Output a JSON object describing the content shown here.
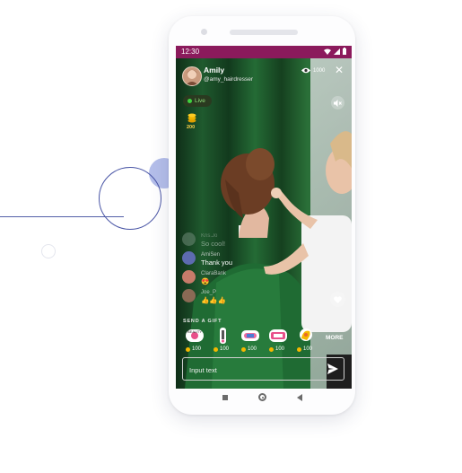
{
  "status_bar": {
    "time": "12:30"
  },
  "stream": {
    "host_name": "Amily",
    "host_handle": "@amy_hairdresser",
    "viewer_count": "1000",
    "live_label": "Live",
    "coin_balance": "200"
  },
  "comments": [
    {
      "user": "Kris.Jo",
      "message": "So cool!",
      "avatar_color": "#6f8a78"
    },
    {
      "user": "AmiSen",
      "message": "Thank you",
      "avatar_color": "#5d6bb0"
    },
    {
      "user": "ClaraBank",
      "message": "😍",
      "avatar_color": "#c77b6a"
    },
    {
      "user": "Joe_P",
      "message": "👍👍👍",
      "avatar_color": "#8b6a55"
    }
  ],
  "gifts": {
    "title": "SEND A GIFT",
    "items": [
      {
        "icon": "beauty-sticker",
        "price": "100"
      },
      {
        "icon": "hair-dryer-sticker",
        "price": "100"
      },
      {
        "icon": "hair-curler-sticker",
        "price": "100"
      },
      {
        "icon": "bad-hair-day-sticker",
        "price": "100"
      },
      {
        "icon": "hair-brush-sticker",
        "price": "100"
      }
    ],
    "more_label": "MORE"
  },
  "input": {
    "placeholder": "Input text"
  },
  "colors": {
    "status_bar": "#8b1a5c",
    "live_dot": "#3fd13f",
    "coin": "#f5b800",
    "deco_ring": "#4a56a6"
  }
}
